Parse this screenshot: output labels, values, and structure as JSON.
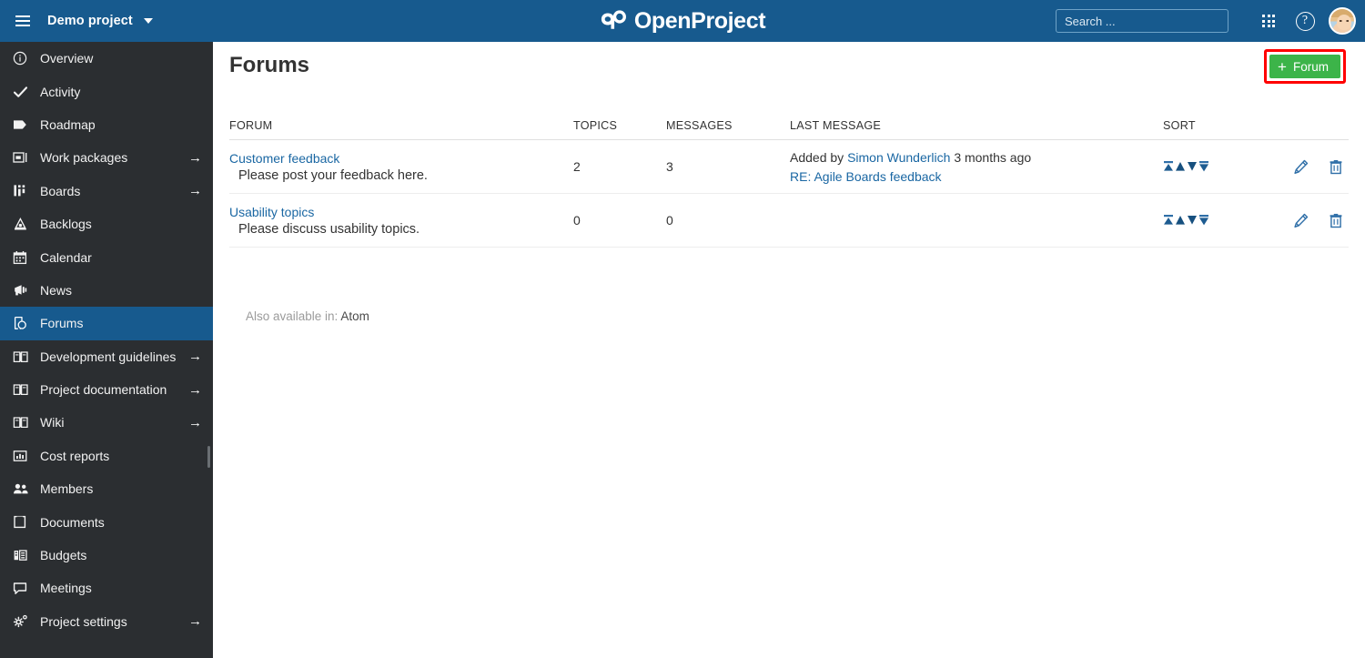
{
  "header": {
    "menu_icon": "hamburger-icon",
    "project_name": "Demo project",
    "project_dropdown_icon": "chevron-down-icon",
    "logo_text": "OpenProject",
    "logo_icon": "openproject-logo-icon",
    "search_placeholder": "Search ...",
    "search_value": "",
    "search_icon": "search-icon",
    "modules_icon": "grid-apps-icon",
    "help_icon": "help-circle-icon",
    "help_glyph": "?",
    "avatar_icon": "user-avatar",
    "background_color": "#175A8E"
  },
  "sidebar": {
    "background_color": "#2B2E31",
    "active_color": "#175A8E",
    "items": [
      {
        "label": "Overview",
        "icon": "info-circle-icon",
        "arrow": "",
        "active": false
      },
      {
        "label": "Activity",
        "icon": "check-icon",
        "arrow": "",
        "active": false
      },
      {
        "label": "Roadmap",
        "icon": "tag-icon",
        "arrow": "",
        "active": false
      },
      {
        "label": "Work packages",
        "icon": "work-packages-icon",
        "arrow": "→",
        "active": false
      },
      {
        "label": "Boards",
        "icon": "boards-icon",
        "arrow": "→",
        "active": false
      },
      {
        "label": "Backlogs",
        "icon": "backlogs-icon",
        "arrow": "",
        "active": false
      },
      {
        "label": "Calendar",
        "icon": "calendar-icon",
        "arrow": "",
        "active": false
      },
      {
        "label": "News",
        "icon": "megaphone-icon",
        "arrow": "",
        "active": false
      },
      {
        "label": "Forums",
        "icon": "forums-icon",
        "arrow": "",
        "active": true
      },
      {
        "label": "Development guidelines",
        "icon": "book-icon",
        "arrow": "→",
        "active": false
      },
      {
        "label": "Project documentation",
        "icon": "book-icon",
        "arrow": "→",
        "active": false
      },
      {
        "label": "Wiki",
        "icon": "book-icon",
        "arrow": "→",
        "active": false
      },
      {
        "label": "Cost reports",
        "icon": "cost-reports-icon",
        "arrow": "",
        "active": false
      },
      {
        "label": "Members",
        "icon": "members-icon",
        "arrow": "",
        "active": false
      },
      {
        "label": "Documents",
        "icon": "documents-icon",
        "arrow": "",
        "active": false
      },
      {
        "label": "Budgets",
        "icon": "budgets-icon",
        "arrow": "",
        "active": false
      },
      {
        "label": "Meetings",
        "icon": "meetings-icon",
        "arrow": "",
        "active": false
      },
      {
        "label": "Project settings",
        "icon": "settings-gear-icon",
        "arrow": "→",
        "active": false
      }
    ]
  },
  "main": {
    "page_title": "Forums",
    "new_forum_button": {
      "label": "Forum",
      "plus": "+",
      "color": "#3CB449",
      "highlight_color": "#FF0000"
    },
    "table": {
      "columns": [
        "FORUM",
        "TOPICS",
        "MESSAGES",
        "LAST MESSAGE",
        "SORT"
      ],
      "rows": [
        {
          "name": "Customer feedback",
          "description": "Please post your feedback here.",
          "topics": "2",
          "messages": "3",
          "last_message_prefix": "Added by",
          "last_message_author": "Simon Wunderlich",
          "last_message_time": "3 months ago",
          "last_message_subject": "RE: Agile Boards feedback",
          "sort_icons": [
            "sort-to-top-icon",
            "sort-up-icon",
            "sort-down-icon",
            "sort-to-bottom-icon"
          ],
          "edit_icon": "pencil-edit-icon",
          "delete_icon": "trash-delete-icon"
        },
        {
          "name": "Usability topics",
          "description": "Please discuss usability topics.",
          "topics": "0",
          "messages": "0",
          "last_message_prefix": "",
          "last_message_author": "",
          "last_message_time": "",
          "last_message_subject": "",
          "sort_icons": [
            "sort-to-top-icon",
            "sort-up-icon",
            "sort-down-icon",
            "sort-to-bottom-icon"
          ],
          "edit_icon": "pencil-edit-icon",
          "delete_icon": "trash-delete-icon"
        }
      ]
    },
    "footer": {
      "also_available_label": "Also available in:",
      "atom_link": "Atom"
    }
  }
}
